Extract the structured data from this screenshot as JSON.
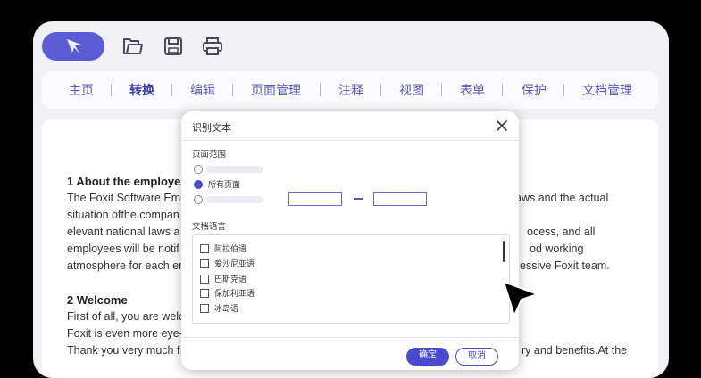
{
  "menu": {
    "items": [
      "主页",
      "转换",
      "编辑",
      "页面管理",
      "注释",
      "视图",
      "表单",
      "保护",
      "文档管理"
    ],
    "active_index": 1
  },
  "document": {
    "lines_left": [
      "1 About the employee",
      "The Foxit Software Emp",
      "situation ofthe compan",
      "elevant national laws a",
      "employees will be notif",
      "atmosphere for each er",
      "2 Welcome",
      "First of all, you are welc",
      " Foxit is even more eye-",
      " Thank you very much f"
    ],
    "lines_right": [
      "aws and the actual",
      "ocess, and all",
      "od working",
      "essive Foxit team.",
      "ry and benefits.At the"
    ]
  },
  "dialog": {
    "title": "识别文本",
    "page_range_label": "页面范围",
    "radio_all_pages": "所有页面",
    "range_dash": "–",
    "language_label": "文档语言",
    "languages": [
      "阿拉伯语",
      "爱沙尼亚语",
      "巴斯克语",
      "保加利亚语",
      "冰岛语"
    ],
    "ok_label": "确定",
    "cancel_label": "取消"
  },
  "icons": {
    "logo": "foxit-logo-icon",
    "open": "folder-icon",
    "save": "save-icon",
    "print": "print-icon",
    "close": "close-icon",
    "cursor": "mouse-pointer-icon"
  },
  "colors": {
    "accent": "#5b5bd6",
    "menu_text": "#5a5ab8"
  }
}
